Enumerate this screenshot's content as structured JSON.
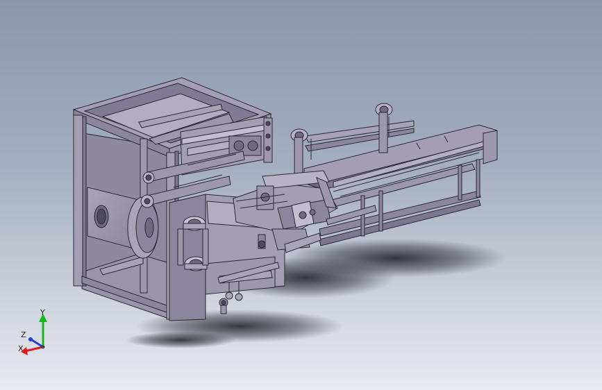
{
  "viewport": {
    "background_top": "#8a97ab",
    "background_bottom": "#e9eaf0"
  },
  "model": {
    "name": "",
    "part_color": "#9d97ae",
    "part_shade": "#6f6a82",
    "edge_color": "#2a2733"
  },
  "triad": {
    "x_label": "X",
    "y_label": "Y",
    "z_label": "Z",
    "x_color": "#e11919",
    "y_color": "#19b619",
    "z_color": "#1f3fd6"
  }
}
